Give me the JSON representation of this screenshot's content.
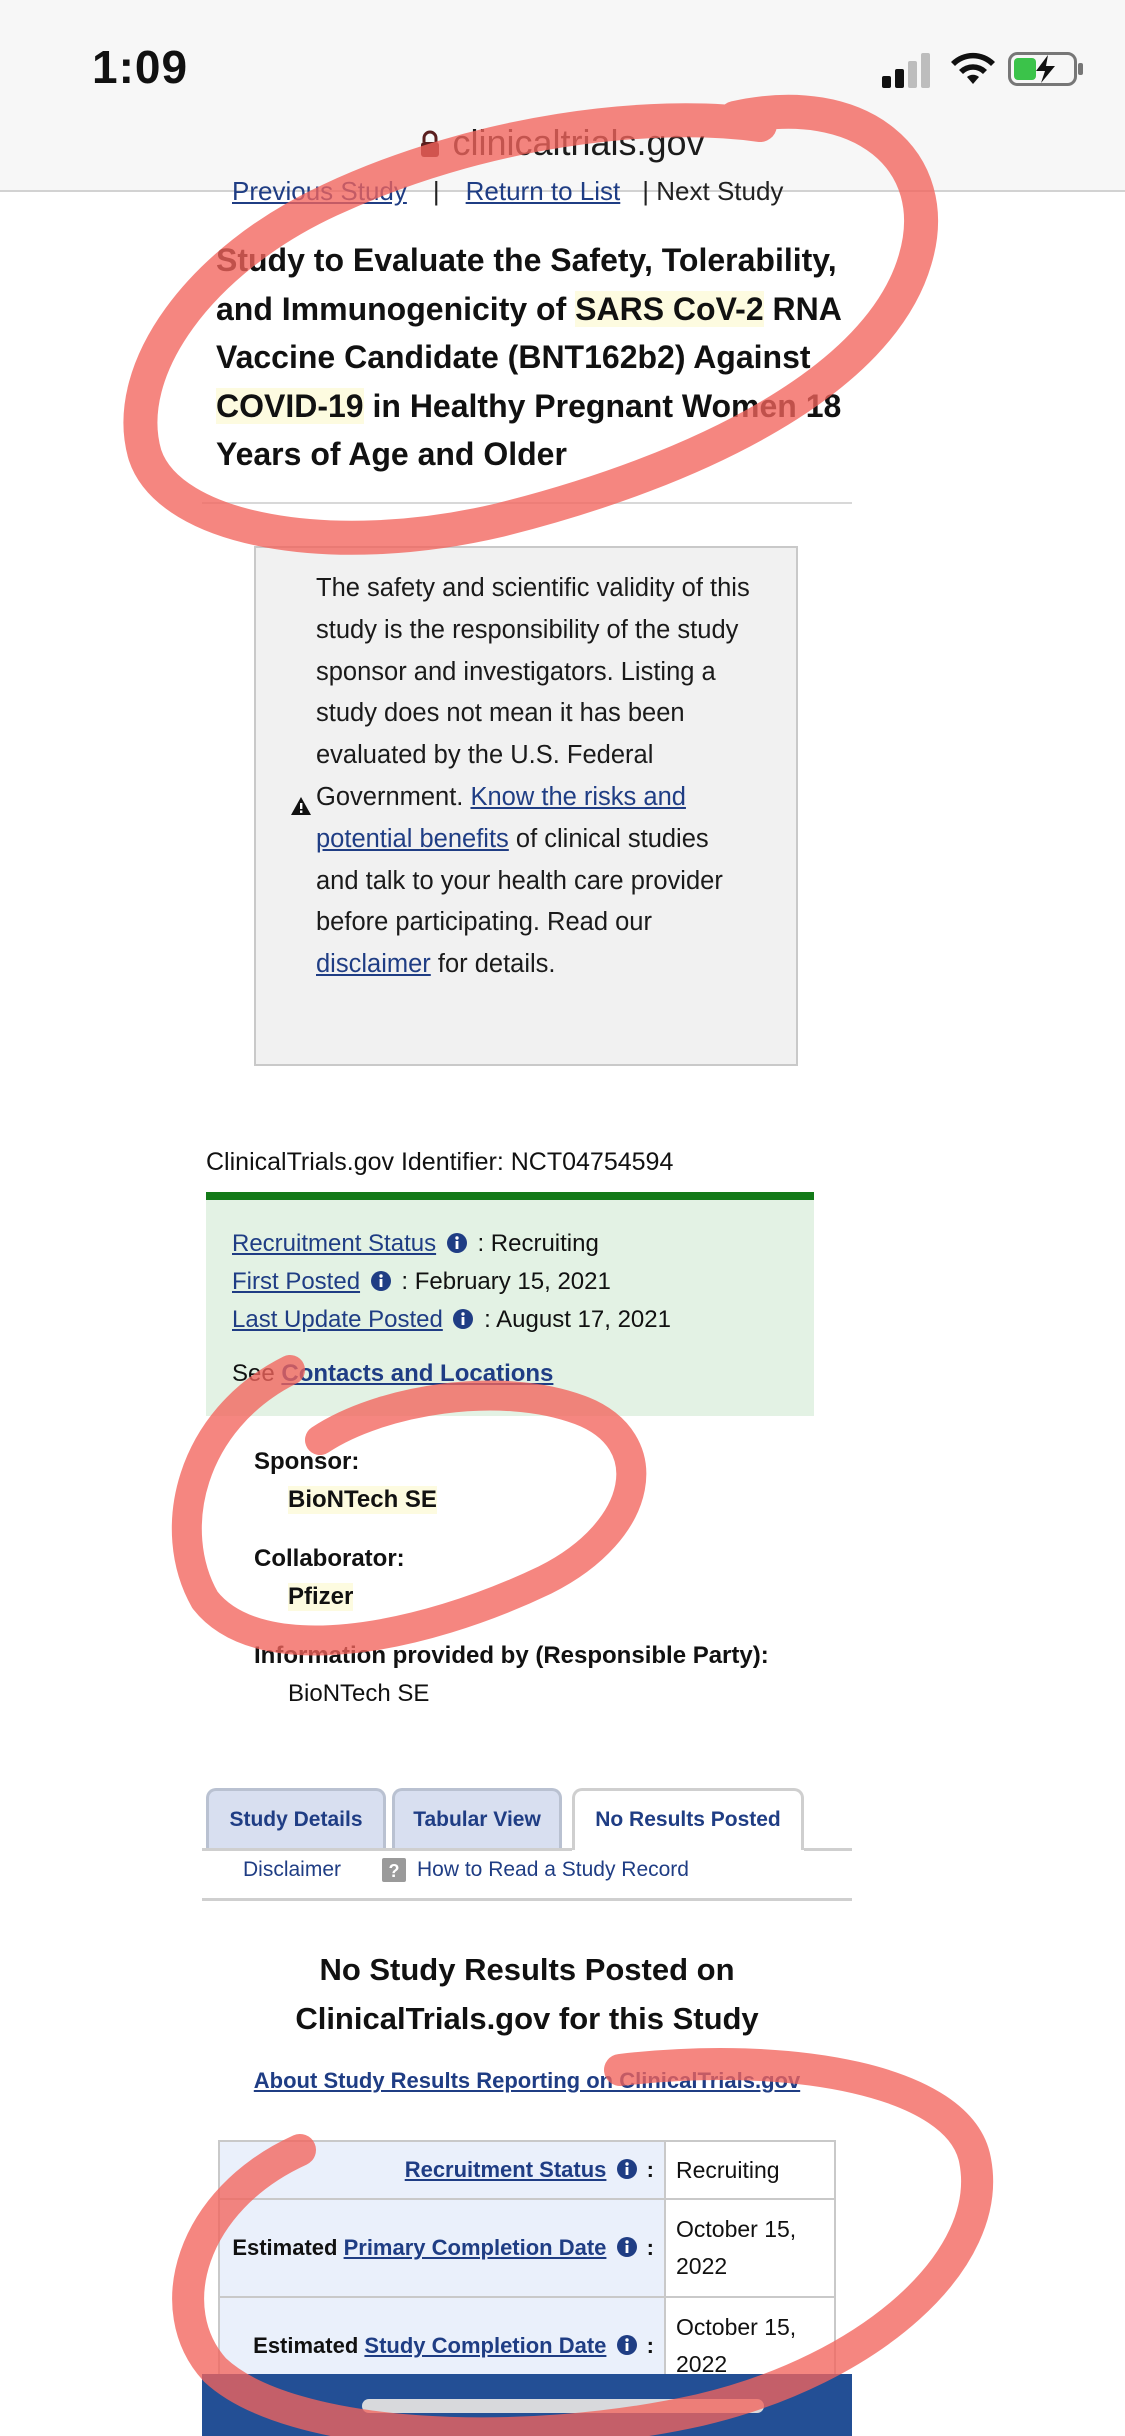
{
  "status_bar": {
    "time": "1:09"
  },
  "browser": {
    "url": "clinicaltrials.gov"
  },
  "study_nav": {
    "previous": "Previous Study",
    "sep1": "|",
    "return": "Return to List",
    "next": "| Next Study"
  },
  "title": {
    "part1": "Study to Evaluate the Safety, Tolerability, and Immunogenicity of ",
    "hl1": "SARS CoV-2",
    "part2": " RNA Vaccine Candidate (BNT162b2) Against ",
    "hl2": "COVID-19",
    "part3": " in Healthy Pregnant Women 18 Years of Age and Older"
  },
  "disclaimer_box": {
    "text1": "The safety and scientific validity of this study is the responsibility of the study sponsor and investigators. Listing a study does not mean it has been evaluated by the U.S. Federal Government. ",
    "risks_link": "Know the risks and potential benefits",
    "text2": " of clinical studies and talk to your health care provider before participating. Read our ",
    "disclaimer_link": "disclaimer",
    "text3": " for details."
  },
  "identifier": "ClinicalTrials.gov Identifier: NCT04754594",
  "status_box": {
    "recruitment_label": "Recruitment Status",
    "recruitment_value": ": Recruiting",
    "first_posted_label": "First Posted",
    "first_posted_value": ": February 15, 2021",
    "last_update_label": "Last Update Posted",
    "last_update_value": ": August 17, 2021",
    "see_text": "See ",
    "contacts_link": "Contacts and Locations"
  },
  "sponsor": {
    "sponsor_label": "Sponsor:",
    "sponsor_value": "BioNTech SE",
    "collaborator_label": "Collaborator:",
    "collaborator_value": "Pfizer",
    "provided_label": "Information provided by (Responsible Party):",
    "provided_value": "BioNTech SE"
  },
  "tabs": {
    "study_details": "Study Details",
    "tabular_view": "Tabular View",
    "no_results": "No Results Posted",
    "disclaimer": "Disclaimer",
    "how_to_read": "How to Read a Study Record"
  },
  "results": {
    "title": "No Study Results Posted on ClinicalTrials.gov for this Study",
    "about_link": "About Study Results Reporting on ClinicalTrials.gov",
    "rows": [
      {
        "prefix": "",
        "label": "Recruitment Status",
        "colon": " :",
        "value": "Recruiting"
      },
      {
        "prefix": "Estimated ",
        "label": "Primary Completion Date",
        "colon": " :",
        "value": "October 15, 2022"
      },
      {
        "prefix": "Estimated ",
        "label": "Study Completion Date",
        "colon": " :",
        "value": "October 15, 2022"
      }
    ]
  },
  "colors": {
    "link": "#1f3d84",
    "status_green": "#137a18",
    "status_bg": "#e3f2e4",
    "highlight": "#fdfbe0",
    "annotation": "#f2645c"
  },
  "icons": [
    "lock-icon",
    "warning-icon",
    "info-icon",
    "help-icon",
    "signal-icon",
    "wifi-icon",
    "battery-charging-icon"
  ]
}
